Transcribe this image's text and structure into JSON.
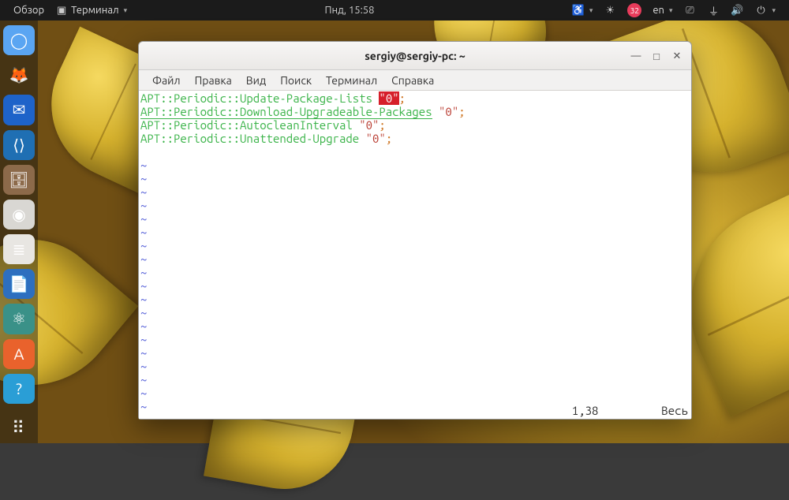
{
  "topbar": {
    "overview": "Обзор",
    "app_indicator": "Терминал",
    "date": "Пнд, 15:58",
    "update_badge": "32",
    "lang": "en"
  },
  "dock": {
    "items": [
      {
        "name": "chromium",
        "bg": "#5aa5f2",
        "glyph": "◯"
      },
      {
        "name": "firefox",
        "bg": "transparent",
        "glyph": "🦊"
      },
      {
        "name": "thunderbird",
        "bg": "#1e63c9",
        "glyph": "✉"
      },
      {
        "name": "vscode",
        "bg": "#1f6fb3",
        "glyph": "⟨⟩"
      },
      {
        "name": "files",
        "bg": "#8c6a4a",
        "glyph": "🗄"
      },
      {
        "name": "rhythmbox",
        "bg": "#d9d7d3",
        "glyph": "◉"
      },
      {
        "name": "libreoffice",
        "bg": "#e8e6e2",
        "glyph": "≣"
      },
      {
        "name": "writer",
        "bg": "#2d6fbf",
        "glyph": "📄"
      },
      {
        "name": "atom",
        "bg": "#3a9188",
        "glyph": "⚛"
      },
      {
        "name": "software",
        "bg": "#e9622c",
        "glyph": "A"
      },
      {
        "name": "help",
        "bg": "#2a9ed6",
        "glyph": "?"
      }
    ]
  },
  "terminal": {
    "title": "sergiy@sergiy-pc: ~",
    "menus": [
      "Файл",
      "Правка",
      "Вид",
      "Поиск",
      "Терминал",
      "Справка"
    ],
    "lines": [
      {
        "key": "APT::Periodic::Update-Package-Lists",
        "val": "0",
        "hl": true
      },
      {
        "key": "APT::Periodic::Download-Upgradeable-Packages",
        "val": "0",
        "underline": true
      },
      {
        "key": "APT::Periodic::AutocleanInterval",
        "val": "0"
      },
      {
        "key": "APT::Periodic::Unattended-Upgrade",
        "val": "0"
      }
    ],
    "tilde_count": 20,
    "status_pos": "1,38",
    "status_mode": "Весь"
  }
}
